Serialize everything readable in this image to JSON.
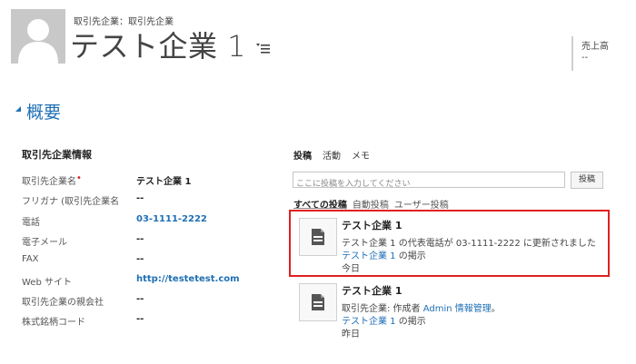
{
  "header": {
    "breadcrumb": "取引先企業：取引先企業",
    "title": "テスト企業 1",
    "kpi_label": "売上高",
    "kpi_value": "--"
  },
  "section": {
    "toggle_icon": "triangle-down-icon",
    "title": "概要"
  },
  "form": {
    "heading": "取引先企業情報",
    "rows": [
      {
        "label": "取引先企業名",
        "required": "•",
        "value": "テスト企業 1"
      },
      {
        "label": "フリガナ (取引先企業名",
        "value": "--"
      },
      {
        "label": "電話",
        "value": "03-1111-2222"
      },
      {
        "label": "電子メール",
        "value": "--"
      },
      {
        "label": "FAX",
        "value": "--"
      },
      {
        "label": "Web サイト",
        "value": "http://testetest.com"
      },
      {
        "label": "取引先企業の親会社",
        "value": "--"
      },
      {
        "label": "株式銘柄コード",
        "value": "--"
      }
    ]
  },
  "posts": {
    "tabs": [
      "投稿",
      "活動",
      "メモ"
    ],
    "input_placeholder": "ここに投稿を入力してください",
    "post_button": "投稿",
    "filters": [
      "すべての投稿",
      "自動投稿",
      "ユーザー投稿"
    ],
    "items": [
      {
        "title": "テスト企業 1",
        "line1": "テスト企業 1 の代表電話が 03-1111-2222 に更新されました",
        "line2_link": "テスト企業 1",
        "line2_rest": " の掲示",
        "time": "今日"
      },
      {
        "title": "テスト企業 1",
        "line1_prefix": "取引先企業: 作成者 ",
        "line1_link": "Admin 情報管理",
        "line1_suffix": "。",
        "line2_link": "テスト企業 1",
        "line2_rest": " の掲示",
        "time": "昨日"
      }
    ]
  },
  "colors": {
    "link": "#1e6fb5",
    "highlight": "#e02020",
    "required": "#dd2222"
  }
}
